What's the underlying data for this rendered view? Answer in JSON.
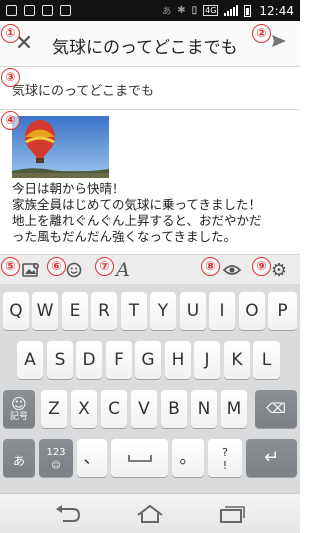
{
  "status_bar": {
    "time": "12:44",
    "chip": "あ",
    "network": "4G",
    "icons": [
      "notification-icon",
      "image-icon",
      "mail-icon",
      "clipboard-icon",
      "bluetooth-icon",
      "vibrate-icon",
      "signal-icon",
      "battery-icon"
    ]
  },
  "header": {
    "title": "気球にのってどこまでも",
    "close_icon": "close-icon",
    "send_icon": "send-icon"
  },
  "title_field": {
    "value": "気球にのってどこまでも"
  },
  "post": {
    "image": "hot-air-balloon-photo",
    "lines": [
      "今日は朝から快晴！",
      "家族全員はじめての気球に乗ってきました！",
      "地上を離れぐんぐん上昇すると、おだやかだ",
      "った風もだんだん強くなってきました。"
    ]
  },
  "badges": [
    "①",
    "②",
    "③",
    "④",
    "⑤",
    "⑥",
    "⑦",
    "⑧",
    "⑨"
  ],
  "toolbar": {
    "icons": [
      "add-photo-icon",
      "emoji-icon",
      "text-style-icon",
      "preview-icon",
      "settings-icon"
    ]
  },
  "keyboard": {
    "row1": [
      "Q",
      "W",
      "E",
      "R",
      "T",
      "Y",
      "U",
      "I",
      "O",
      "P"
    ],
    "row2": [
      "A",
      "S",
      "D",
      "F",
      "G",
      "H",
      "J",
      "K",
      "L"
    ],
    "row3": [
      "Z",
      "X",
      "C",
      "V",
      "B",
      "N",
      "M"
    ],
    "symbols_label": "記号",
    "kana_label": "あ",
    "num_label": "123",
    "comma": "、",
    "period": "。",
    "question": "?",
    "exclaim": "!"
  },
  "nav_bar": {
    "icons": [
      "back-icon",
      "home-icon",
      "recent-apps-icon"
    ]
  },
  "colors": {
    "badge": "#e03030",
    "status_bar": "#121212",
    "keyboard": "#d9dbdd"
  }
}
